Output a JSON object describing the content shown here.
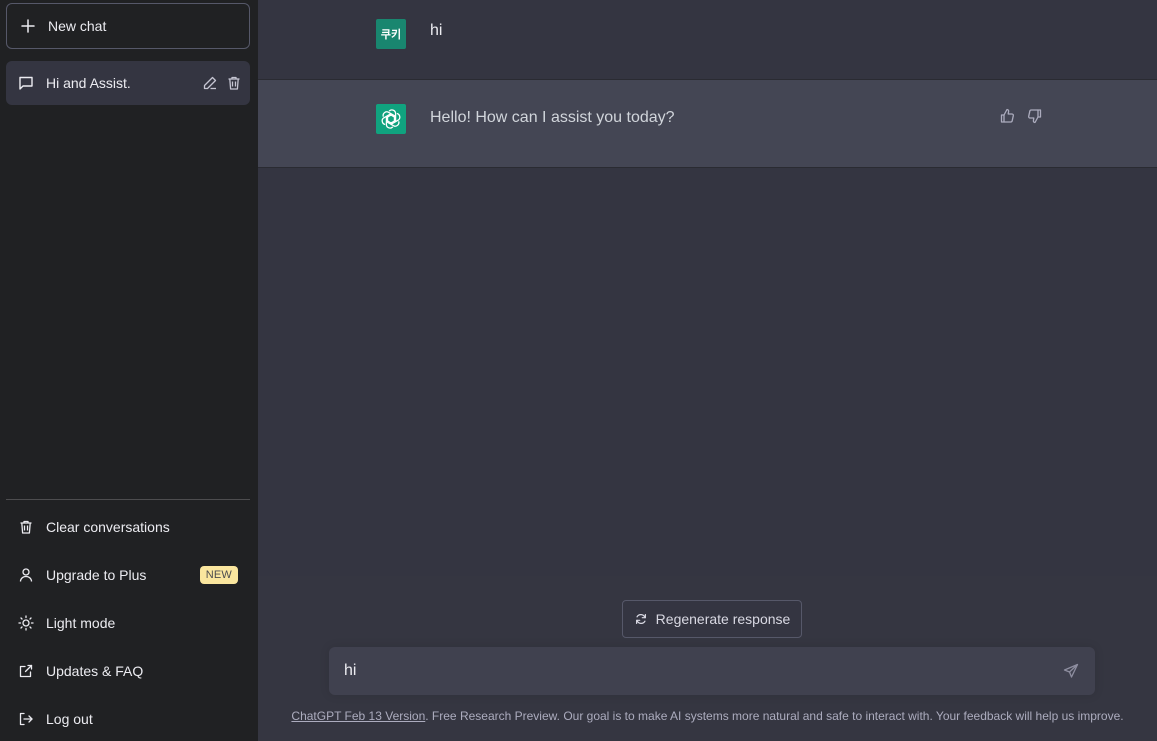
{
  "sidebar": {
    "new_chat_label": "New chat",
    "conversations": [
      {
        "title": "Hi and Assist."
      }
    ],
    "menu": {
      "clear": "Clear conversations",
      "upgrade": "Upgrade to Plus",
      "upgrade_badge": "NEW",
      "light_mode": "Light mode",
      "updates": "Updates & FAQ",
      "logout": "Log out"
    }
  },
  "chat": {
    "user_avatar_text": "쿠키",
    "user_message": "hi",
    "assistant_message": "Hello! How can I assist you today?"
  },
  "composer": {
    "regenerate_label": "Regenerate response",
    "input_value": "hi"
  },
  "footer": {
    "version_link": "ChatGPT Feb 13 Version",
    "text": ". Free Research Preview. Our goal is to make AI systems more natural and safe to interact with. Your feedback will help us improve."
  },
  "colors": {
    "sidebar_bg": "#202123",
    "main_bg": "#343541",
    "assistant_row_bg": "#444654",
    "user_avatar": "#19866f",
    "assistant_avatar": "#10a37f",
    "badge_bg": "#fae69e"
  }
}
